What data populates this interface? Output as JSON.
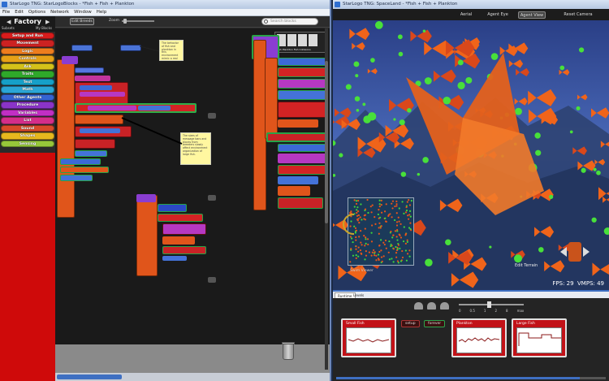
{
  "left_window": {
    "title": "StarLogo TNG: StarLogoBlocks - *Fish + Fish + Plankton",
    "menu": [
      "File",
      "Edit",
      "Options",
      "Network",
      "Window",
      "Help"
    ],
    "factory": {
      "title": "Factory",
      "sub_left": "Subsets",
      "sub_right": "My Blocks"
    },
    "drawers": [
      {
        "label": "Setup and Run",
        "color": "#d81c1c"
      },
      {
        "label": "Movement",
        "color": "#cc2222"
      },
      {
        "label": "Logic",
        "color": "#ee7d1e"
      },
      {
        "label": "Controls",
        "color": "#e6a117"
      },
      {
        "label": "Ask",
        "color": "#d4c21a"
      },
      {
        "label": "Traits",
        "color": "#2fa82a"
      },
      {
        "label": "Text",
        "color": "#16a0c8"
      },
      {
        "label": "Math",
        "color": "#2aa6d6"
      },
      {
        "label": "Other Agents",
        "color": "#3563d1"
      },
      {
        "label": "Procedure",
        "color": "#8a34c8"
      },
      {
        "label": "Variables",
        "color": "#c12fc4"
      },
      {
        "label": "List",
        "color": "#d42e8a"
      },
      {
        "label": "Sound",
        "color": "#d84a2a"
      },
      {
        "label": "Shapes",
        "color": "#e6b81e"
      },
      {
        "label": "Sensing",
        "color": "#97c73a"
      }
    ],
    "toolbar": {
      "edit_breeds": "Edit Breeds",
      "zoom_label": "Zoom",
      "search_placeholder": "Search blocks"
    },
    "notes": [
      "The behavior of fish and plankton in this environment mimic a real underwater ecosystem.",
      "The sizes of message bars and blocks from breeders slowly affect environment organization of large fish."
    ],
    "preview_caption": "Fish   Plankton   Fish   Collisions"
  },
  "right_window": {
    "title": "StarLogo TNG: SpaceLand - *Fish + Fish + Plankton",
    "view_tabs": [
      {
        "label": "Aerial",
        "active": false
      },
      {
        "label": "Agent Eye",
        "active": false
      },
      {
        "label": "Agent View",
        "active": true
      },
      {
        "label": "Reset Camera",
        "active": false
      }
    ],
    "minimap_label": "Swim Viewer",
    "edit_terrain": "Edit Terrain",
    "fps": "FPS: 29",
    "vmps": "VMPS: 49",
    "bottom_tabs": [
      "Runtime",
      "Levels"
    ],
    "speed_ticks": [
      "0",
      "0.5",
      "1",
      "2",
      "8",
      "max"
    ],
    "buttons": [
      {
        "label": "setup",
        "on": false
      },
      {
        "label": "forever",
        "on": true
      }
    ],
    "graphs": [
      {
        "title": "Small Fish",
        "type": "line"
      },
      {
        "title": "Plankton",
        "type": "line"
      },
      {
        "title": "Large Fish",
        "type": "step"
      }
    ]
  }
}
